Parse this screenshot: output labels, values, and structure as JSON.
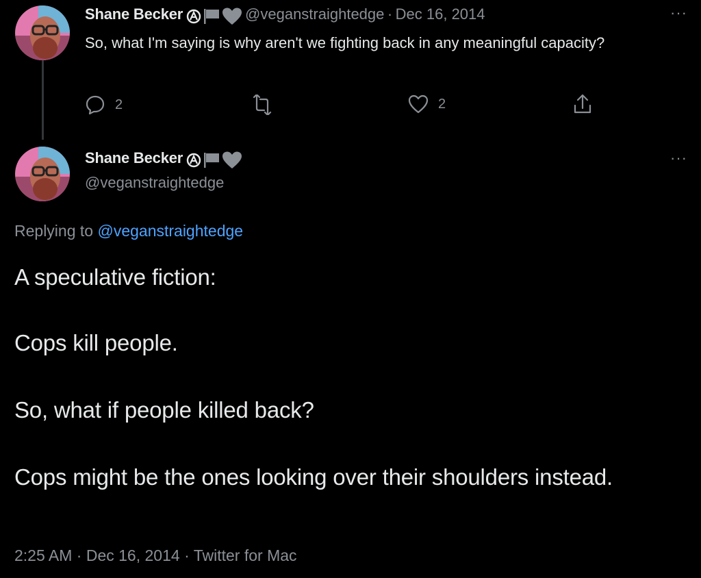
{
  "tweet1": {
    "author_name": "Shane Becker",
    "handle": "@veganstraightedge",
    "separator": "·",
    "date": "Dec 16, 2014",
    "text": "So, what I'm saying is why aren't we fighting back in any meaningful capacity?",
    "more": "···",
    "actions": {
      "reply_count": "2",
      "retweet_count": "",
      "like_count": "2"
    },
    "icons": [
      "anarchy-icon",
      "flag-icon",
      "heart-badge-icon",
      "reply-icon",
      "retweet-icon",
      "like-icon",
      "share-icon"
    ]
  },
  "tweet2": {
    "author_name": "Shane Becker",
    "handle": "@veganstraightedge",
    "more": "···",
    "replying_prefix": "Replying to",
    "replying_handle": "@veganstraightedge",
    "paragraphs": [
      "A speculative fiction:",
      "Cops kill people.",
      "So, what if people killed back?",
      "Cops might be the ones looking over their shoulders instead."
    ],
    "time": "2:25 AM",
    "date": "Dec 16, 2014",
    "source": "Twitter for Mac",
    "separator": "·"
  },
  "colors": {
    "background": "#000000",
    "text": "#e7e9ea",
    "muted": "#8b9096",
    "link": "#4da3ff"
  }
}
